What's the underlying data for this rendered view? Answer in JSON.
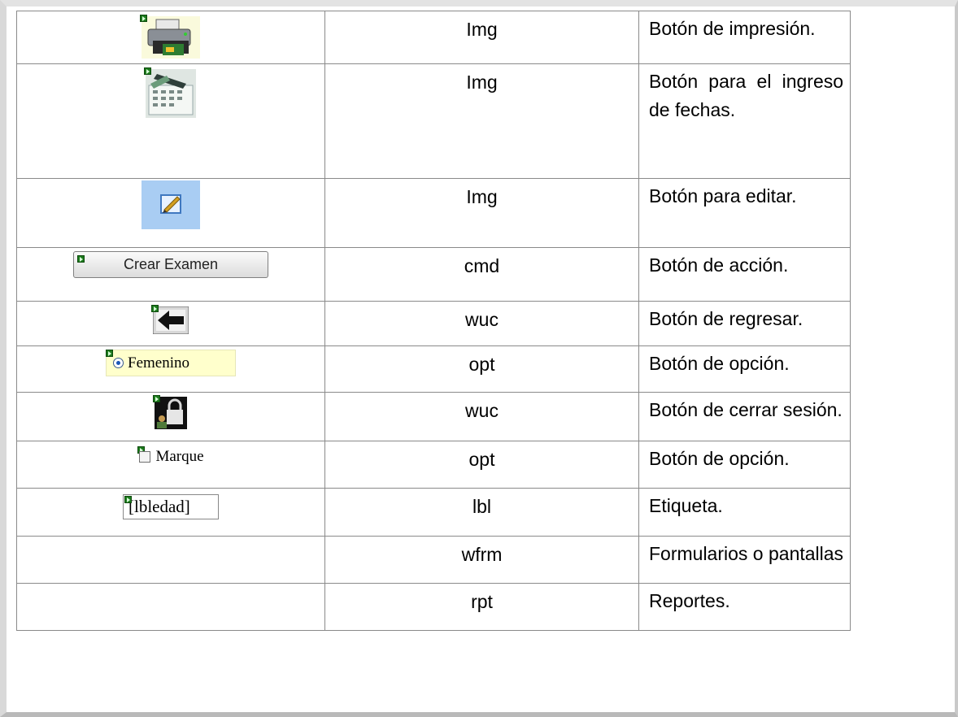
{
  "rows": [
    {
      "icon": "printer-icon",
      "type": "Img",
      "description": "Botón de impresión."
    },
    {
      "icon": "calendar-date-icon",
      "type": "Img",
      "description": "Botón para el ingreso de fechas."
    },
    {
      "icon": "edit-pencil-icon",
      "type": "Img",
      "description": "Botón para editar."
    },
    {
      "icon": "button-sample",
      "sample_text": "Crear Examen",
      "type": "cmd",
      "description": "Botón de acción."
    },
    {
      "icon": "back-arrow-icon",
      "type": "wuc",
      "description": "Botón de regresar."
    },
    {
      "icon": "radio-sample",
      "sample_text": "Femenino",
      "type": "opt",
      "description": "Botón de opción."
    },
    {
      "icon": "lock-logout-icon",
      "type": "wuc",
      "description": "Botón de cerrar sesión."
    },
    {
      "icon": "checkbox-sample",
      "sample_text": "Marque",
      "type": "opt",
      "description": "Botón de opción."
    },
    {
      "icon": "label-sample",
      "sample_text": "[lbledad]",
      "type": "lbl",
      "description": "Etiqueta."
    },
    {
      "icon": "",
      "type": "wfrm",
      "description": "Formularios o pantallas"
    },
    {
      "icon": "",
      "type": "rpt",
      "description": "Reportes."
    }
  ]
}
